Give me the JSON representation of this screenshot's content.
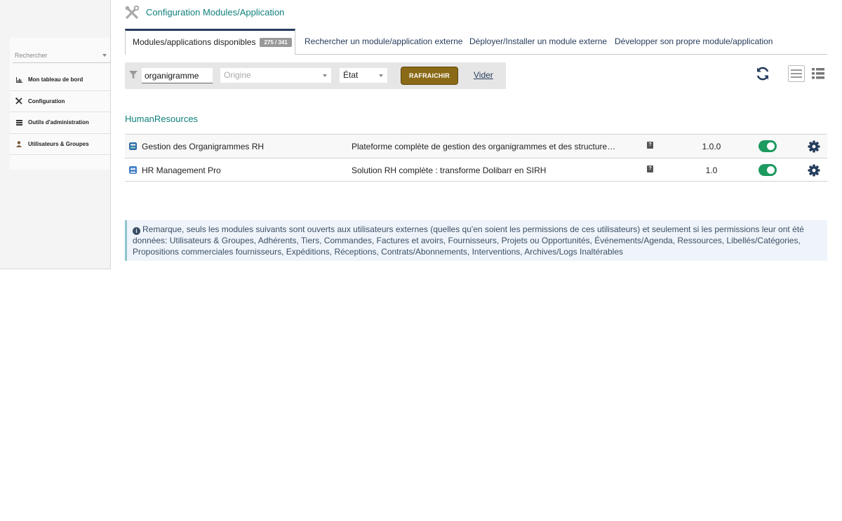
{
  "sidebar": {
    "search_placeholder": "Rechercher",
    "items": [
      {
        "label": "Mon tableau de bord",
        "icon": "bar-chart-icon"
      },
      {
        "label": "Configuration",
        "icon": "tools-icon"
      },
      {
        "label": "Outils d'administration",
        "icon": "server-icon"
      },
      {
        "label": "Utilisateurs & Groupes",
        "icon": "user-icon"
      }
    ]
  },
  "page": {
    "title": "Configuration Modules/Application"
  },
  "tabs": {
    "available": {
      "label": "Modules/applications disponibles",
      "badge": "275 / 341"
    },
    "search_external": "Rechercher un module/application externe",
    "deploy_external": "Déployer/Installer un module externe",
    "develop_own": "Développer son propre module/application"
  },
  "filters": {
    "search_value": "organigramme",
    "origin_placeholder": "Origine",
    "state_value": "État",
    "refresh_label": "RAFRAICHIR",
    "clear_label": "Vider"
  },
  "group": {
    "title": "HumanResources"
  },
  "modules": [
    {
      "name": "Gestion des Organigrammes RH",
      "description": "Plateforme complète de gestion des organigrammes et des structures organ...",
      "version": "1.0.0",
      "enabled": true,
      "icon_color": "#2e6ea8"
    },
    {
      "name": "HR Management Pro",
      "description": "Solution RH complète : transforme Dolibarr en SIRH",
      "version": "1.0",
      "enabled": true,
      "icon_color": "#3f7ec6"
    }
  ],
  "info": {
    "text": "Remarque, seuls les modules suivants sont ouverts aux utilisateurs externes (quelles qu'en soient les permissions de ces utilisateurs) et seulement si les permissions leur ont été données: Utilisateurs & Groupes, Adhérents, Tiers, Commandes, Factures et avoirs, Fournisseurs, Projets ou Opportunités, Événements/Agenda, Ressources, Libellés/Catégories, Propositions commerciales fournisseurs, Expéditions, Réceptions, Contrats/Abonnements, Interventions, Archives/Logs Inaltérables"
  },
  "colors": {
    "accent": "#10807c",
    "nav_text": "#263c5c",
    "refresh_button": "#8b6a17",
    "toggle_on": "#1d9a5f"
  }
}
